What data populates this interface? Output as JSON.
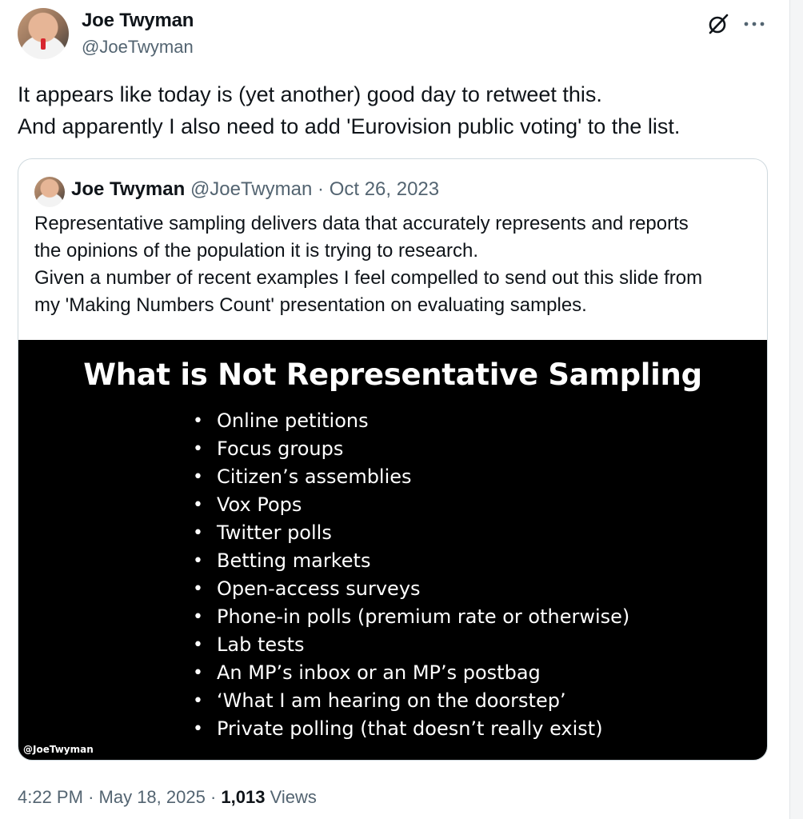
{
  "author": {
    "name": "Joe Twyman",
    "handle": "@JoeTwyman"
  },
  "icons": {
    "grok": "grok-icon",
    "more": "more-icon"
  },
  "tweet": {
    "lines": [
      "It appears like today is (yet another) good day to retweet this.",
      "And apparently I also need to add 'Eurovision public voting' to the list."
    ],
    "time": "4:22 PM",
    "date": "May 18, 2025",
    "views_count": "1,013",
    "views_label": "Views"
  },
  "quote": {
    "name": "Joe Twyman",
    "handle": "@JoeTwyman",
    "date": "Oct 26, 2023",
    "lines": [
      "Representative sampling delivers data that accurately represents and reports",
      "the opinions of the population it is trying to research.",
      "Given a number of recent examples I feel compelled to send out this slide from",
      "my 'Making Numbers Count' presentation on evaluating samples."
    ],
    "slide": {
      "title": "What is Not Representative Sampling",
      "items": [
        "Online petitions",
        "Focus groups",
        "Citizen’s assemblies",
        "Vox Pops",
        "Twitter polls",
        "Betting markets",
        "Open-access surveys",
        "Phone-in polls (premium rate or otherwise)",
        "Lab tests",
        "An MP’s inbox or an MP’s postbag",
        "‘What I am hearing on the doorstep’",
        "Private polling (that doesn’t really exist)"
      ],
      "watermark": "@JoeTwyman"
    }
  }
}
